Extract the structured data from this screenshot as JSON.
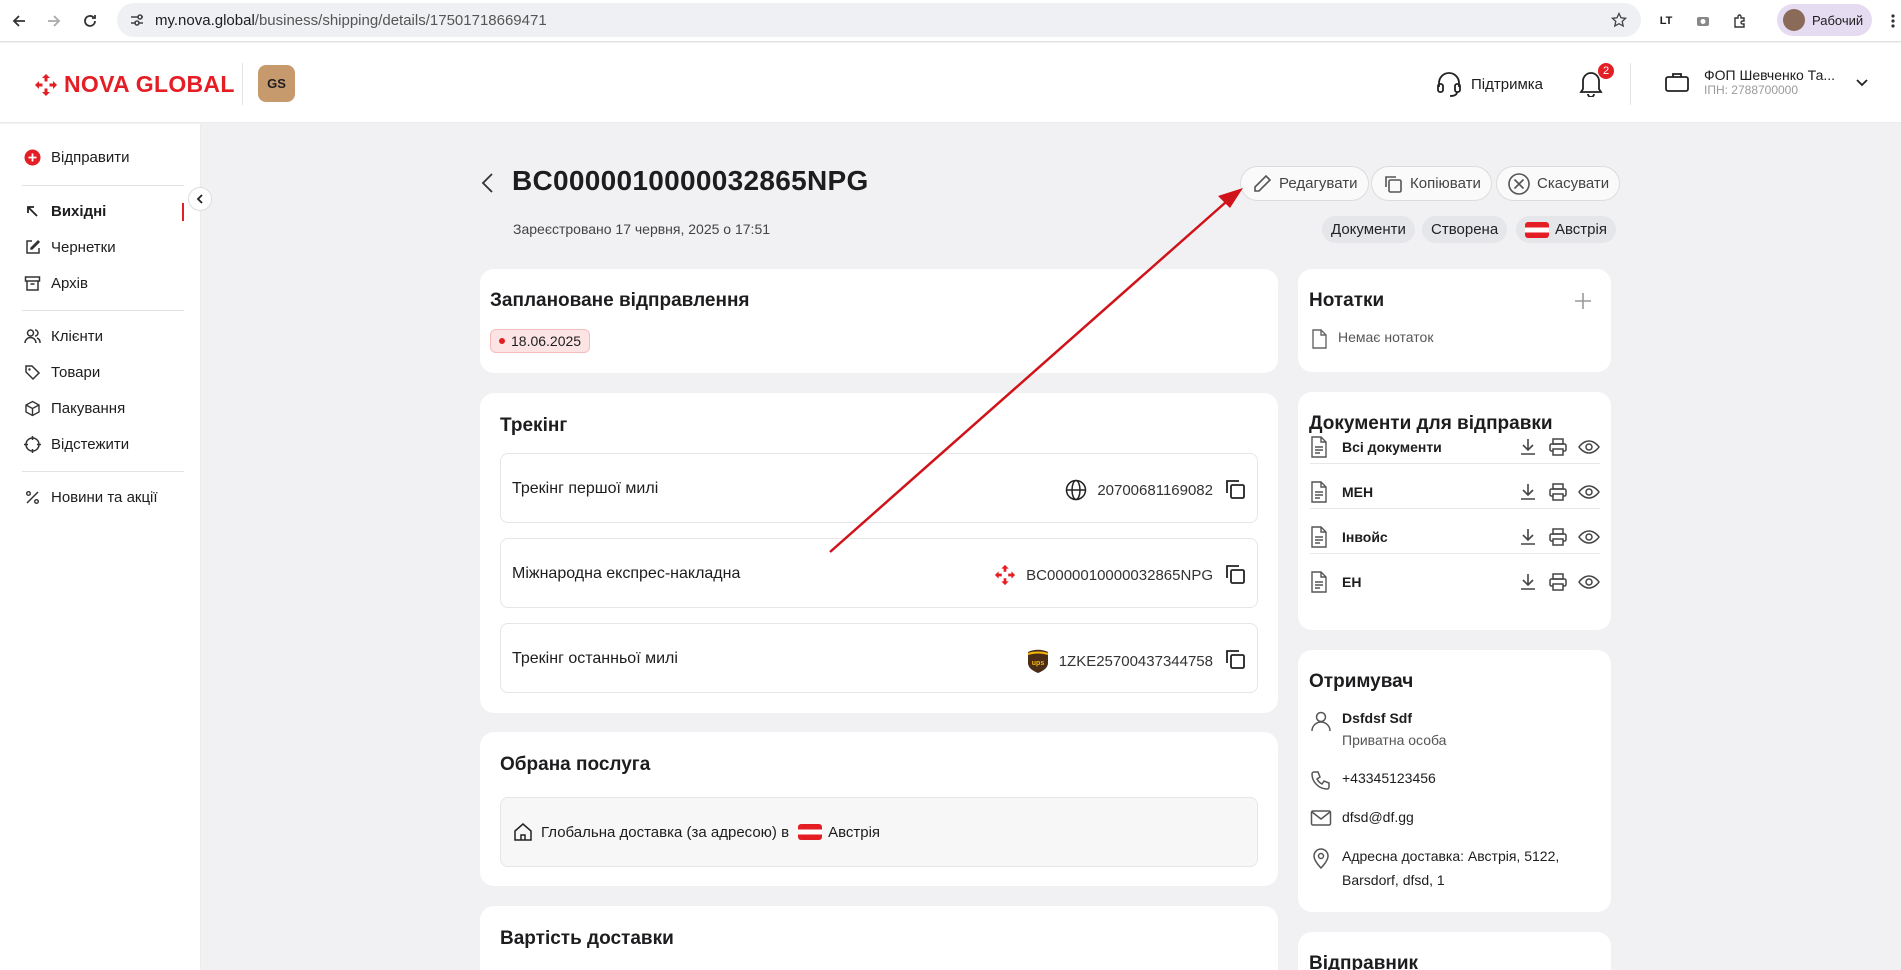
{
  "browser": {
    "url_domain": "my.nova.global",
    "url_path": "/business/shipping/details/17501718669471",
    "profile_label": "Рабочий"
  },
  "header": {
    "logo_text": "NOVA GLOBAL",
    "gs_badge": "GS",
    "support_label": "Підтримка",
    "notifications_count": "2",
    "account_name": "ФОП Шевченко Та...",
    "account_inn": "ІПН: 2788700000"
  },
  "sidebar": {
    "send": "Відправити",
    "outgoing": "Вихідні",
    "drafts": "Чернетки",
    "archive": "Архів",
    "clients": "Клієнти",
    "goods": "Товари",
    "packaging": "Пакування",
    "track": "Відстежити",
    "news": "Новини та акції"
  },
  "shipment": {
    "number": "BC0000010000032865NPG",
    "registered": "Зареєстровано 17 червня, 2025 о 17:51",
    "actions": {
      "edit": "Редагувати",
      "copy": "Копіювати",
      "cancel": "Скасувати"
    },
    "chips": {
      "documents": "Документи",
      "status": "Створена",
      "country": "Австрія"
    }
  },
  "planned": {
    "title": "Заплановане відправлення",
    "date": "18.06.2025"
  },
  "tracking": {
    "title": "Трекінг",
    "rows": [
      {
        "label": "Трекінг першої милі",
        "value": "20700681169082",
        "icon": "globe-icon"
      },
      {
        "label": "Міжнародна експрес-накладна",
        "value": "BC0000010000032865NPG",
        "icon": "nova-logo-icon"
      },
      {
        "label": "Трекінг останньої милі",
        "value": "1ZKE25700437344758",
        "icon": "ups-logo-icon"
      }
    ]
  },
  "service": {
    "title": "Обрана послуга",
    "text": "Глобальна доставка (за адресою) в",
    "country": "Австрія"
  },
  "cost": {
    "title": "Вартість доставки"
  },
  "notes": {
    "title": "Нотатки",
    "empty": "Немає нотаток"
  },
  "documents": {
    "title": "Документи для відправки",
    "items": [
      "Всі документи",
      "МЕН",
      "Інвойс",
      "ЕН"
    ]
  },
  "recipient": {
    "title": "Отримувач",
    "name": "Dsfdsf Sdf",
    "type": "Приватна особа",
    "phone": "+43345123456",
    "email": "dfsd@df.gg",
    "address_1": "Адресна доставка: Австрія, 5122,",
    "address_2": "Barsdorf, dfsd, 1"
  },
  "sender": {
    "title": "Відправник"
  },
  "colors": {
    "brand": "#e31e24",
    "annotation_arrow": "#d0131a"
  }
}
